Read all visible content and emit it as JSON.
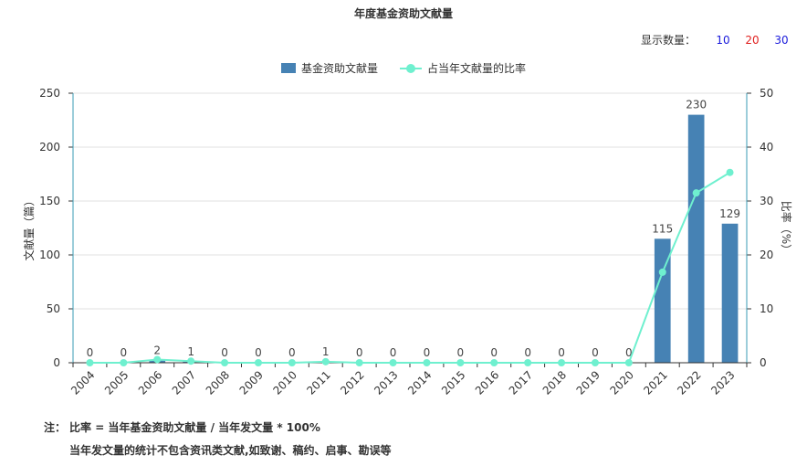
{
  "header": {
    "title": "年度基金资助文献量"
  },
  "count_selector": {
    "label": "显示数量：",
    "options": [
      {
        "label": "10",
        "color": "#1a1adb"
      },
      {
        "label": "20",
        "color": "#e0201f"
      },
      {
        "label": "30",
        "color": "#1a1adb"
      }
    ]
  },
  "notes": {
    "prefix": "注：",
    "line1": "比率 = 当年基金资助文献量 / 当年发文量 * 100%",
    "line2": "当年发文量的统计不包含资讯类文献,如致谢、稿约、启事、勘误等"
  },
  "chart_data": {
    "type": "bar",
    "categories": [
      "2004",
      "2005",
      "2006",
      "2007",
      "2008",
      "2009",
      "2010",
      "2011",
      "2012",
      "2013",
      "2014",
      "2015",
      "2016",
      "2017",
      "2018",
      "2019",
      "2020",
      "2021",
      "2022",
      "2023"
    ],
    "series": [
      {
        "name": "基金资助文献量",
        "type": "bar",
        "axis": "left",
        "color": "#4682b4",
        "values": [
          0,
          0,
          2,
          1,
          0,
          0,
          0,
          1,
          0,
          0,
          0,
          0,
          0,
          0,
          0,
          0,
          0,
          115,
          230,
          129
        ]
      },
      {
        "name": "占当年文献量的比率",
        "type": "line",
        "axis": "right",
        "color": "#6ff0cf",
        "values": [
          0,
          0,
          0.6,
          0.3,
          0,
          0,
          0,
          0.2,
          0,
          0,
          0,
          0,
          0,
          0,
          0,
          0,
          0,
          16.8,
          31.5,
          35.3
        ]
      }
    ],
    "ylabel": "文献量（篇）",
    "ylim": [
      0,
      250
    ],
    "yticks": [
      0,
      50,
      100,
      150,
      200,
      250
    ],
    "y2label": "比率（%）",
    "y2lim": [
      0,
      50
    ],
    "y2ticks": [
      0,
      10,
      20,
      30,
      40,
      50
    ],
    "grid": true,
    "legend_position": "top-center"
  }
}
